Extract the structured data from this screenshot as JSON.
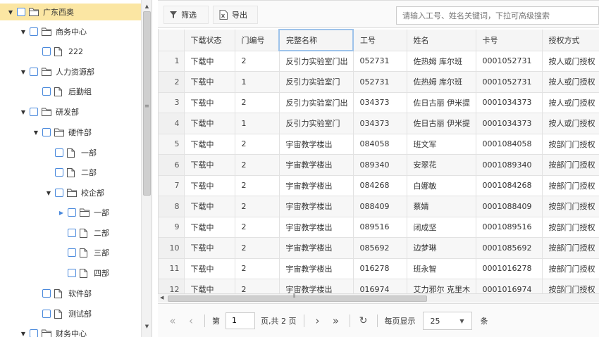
{
  "tree": {
    "nodes": [
      {
        "label": "广东西奥",
        "type": "folder",
        "expanded": true,
        "selected": true
      },
      {
        "label": "商务中心",
        "type": "folder",
        "expanded": true
      },
      {
        "label": "222",
        "type": "file"
      },
      {
        "label": "人力资源部",
        "type": "folder",
        "expanded": true
      },
      {
        "label": "后勤组",
        "type": "file"
      },
      {
        "label": "研发部",
        "type": "folder",
        "expanded": true
      },
      {
        "label": "硬件部",
        "type": "folder",
        "expanded": true
      },
      {
        "label": "一部",
        "type": "file"
      },
      {
        "label": "二部",
        "type": "file"
      },
      {
        "label": "校企部",
        "type": "folder",
        "expanded": true
      },
      {
        "label": "一部",
        "type": "folder",
        "expanded": false
      },
      {
        "label": "二部",
        "type": "file"
      },
      {
        "label": "三部",
        "type": "file"
      },
      {
        "label": "四部",
        "type": "file"
      },
      {
        "label": "软件部",
        "type": "file"
      },
      {
        "label": "测试部",
        "type": "file"
      },
      {
        "label": "财务中心",
        "type": "folder",
        "expanded": true
      }
    ]
  },
  "toolbar": {
    "filter_label": "筛选",
    "export_label": "导出",
    "search_placeholder": "请输入工号、姓名关键词，下拉可高级搜索"
  },
  "grid": {
    "columns": [
      "下载状态",
      "门编号",
      "完整名称",
      "工号",
      "姓名",
      "卡号",
      "授权方式"
    ],
    "rows": [
      {
        "n": "1",
        "status": "下载中",
        "door": "2",
        "name": "反引力实验室门出",
        "id": "052731",
        "person": "佐热姆 库尔班",
        "card": "0001052731",
        "auth": "按人或门授权"
      },
      {
        "n": "2",
        "status": "下载中",
        "door": "1",
        "name": "反引力实验室门",
        "id": "052731",
        "person": "佐热姆 库尔班",
        "card": "0001052731",
        "auth": "按人或门授权"
      },
      {
        "n": "3",
        "status": "下载中",
        "door": "2",
        "name": "反引力实验室门出",
        "id": "034373",
        "person": "佐日古丽 伊米提",
        "card": "0001034373",
        "auth": "按人或门授权"
      },
      {
        "n": "4",
        "status": "下载中",
        "door": "1",
        "name": "反引力实验室门",
        "id": "034373",
        "person": "佐日古丽 伊米提",
        "card": "0001034373",
        "auth": "按人或门授权"
      },
      {
        "n": "5",
        "status": "下载中",
        "door": "2",
        "name": "宇宙教学楼出",
        "id": "084058",
        "person": "班文军",
        "card": "0001084058",
        "auth": "按部门门授权"
      },
      {
        "n": "6",
        "status": "下载中",
        "door": "2",
        "name": "宇宙教学楼出",
        "id": "089340",
        "person": "安翠花",
        "card": "0001089340",
        "auth": "按部门门授权"
      },
      {
        "n": "7",
        "status": "下载中",
        "door": "2",
        "name": "宇宙教学楼出",
        "id": "084268",
        "person": "白娜敏",
        "card": "0001084268",
        "auth": "按部门门授权"
      },
      {
        "n": "8",
        "status": "下载中",
        "door": "2",
        "name": "宇宙教学楼出",
        "id": "088409",
        "person": "蔡婧",
        "card": "0001088409",
        "auth": "按部门门授权"
      },
      {
        "n": "9",
        "status": "下载中",
        "door": "2",
        "name": "宇宙教学楼出",
        "id": "089516",
        "person": "闭成坚",
        "card": "0001089516",
        "auth": "按部门门授权"
      },
      {
        "n": "10",
        "status": "下载中",
        "door": "2",
        "name": "宇宙教学楼出",
        "id": "085692",
        "person": "边梦琳",
        "card": "0001085692",
        "auth": "按部门门授权"
      },
      {
        "n": "11",
        "status": "下载中",
        "door": "2",
        "name": "宇宙教学楼出",
        "id": "016278",
        "person": "班永智",
        "card": "0001016278",
        "auth": "按部门门授权"
      },
      {
        "n": "12",
        "status": "下载中",
        "door": "2",
        "name": "宇宙教学楼出",
        "id": "016974",
        "person": "艾力邪尔 克里木",
        "card": "0001016974",
        "auth": "按部门门授权"
      }
    ]
  },
  "pager": {
    "page_label": "第",
    "page_value": "1",
    "total_label": "页,共 2 页",
    "per_page_label": "每页显示",
    "page_size": "25",
    "unit_label": "条"
  }
}
